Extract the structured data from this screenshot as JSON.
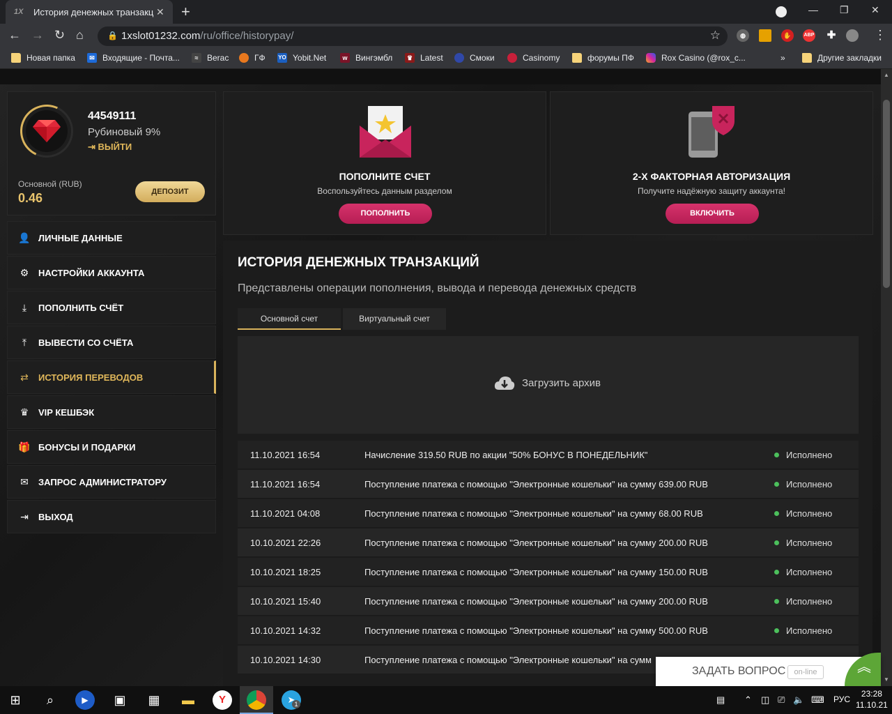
{
  "browser": {
    "tab_title": "История денежных транзакций",
    "tab_favicon": "1X",
    "url_host": "1xslot01232.com",
    "url_path": "/ru/office/historypay/",
    "bookmarks": [
      {
        "label": "Новая папка",
        "icon": "folder-icon"
      },
      {
        "label": "Входящие - Почта...",
        "icon": "mail-icon"
      },
      {
        "label": "Berac",
        "icon": "berac-icon"
      },
      {
        "label": "ГФ",
        "icon": "gf-icon"
      },
      {
        "label": "Yobit.Net",
        "icon": "yobit-icon"
      },
      {
        "label": "Вингэмбл",
        "icon": "wingamble-icon"
      },
      {
        "label": "Latest",
        "icon": "latest-icon"
      },
      {
        "label": "Смоки",
        "icon": "smoki-icon"
      },
      {
        "label": "Casinomy",
        "icon": "casinomy-icon"
      },
      {
        "label": "форумы ПФ",
        "icon": "folder-icon"
      },
      {
        "label": "Rox Casino (@rox_c...",
        "icon": "instagram-icon"
      }
    ],
    "more_bookmarks": "»",
    "other_bookmarks": "Другие закладки",
    "ext_abp": "ABP"
  },
  "profile": {
    "user_id": "44549111",
    "tier": "Рубиновый 9%",
    "logout": "ВЫЙТИ",
    "balance_label": "Основной (RUB)",
    "balance": "0.46",
    "deposit": "ДЕПОЗИТ"
  },
  "menu": [
    {
      "label": "ЛИЧНЫЕ ДАННЫЕ",
      "icon": "user-edit-icon"
    },
    {
      "label": "НАСТРОЙКИ АККАУНТА",
      "icon": "gears-icon"
    },
    {
      "label": "ПОПОЛНИТЬ СЧЁТ",
      "icon": "download-icon"
    },
    {
      "label": "ВЫВЕСТИ СО СЧЁТА",
      "icon": "upload-icon"
    },
    {
      "label": "ИСТОРИЯ ПЕРЕВОДОВ",
      "icon": "transfer-icon",
      "active": true
    },
    {
      "label": "VIP КЕШБЭК",
      "icon": "crown-icon"
    },
    {
      "label": "БОНУСЫ И ПОДАРКИ",
      "icon": "gift-icon"
    },
    {
      "label": "ЗАПРОС АДМИНИСТРАТОРУ",
      "icon": "envelope-icon"
    },
    {
      "label": "ВЫХОД",
      "icon": "exit-icon"
    }
  ],
  "promo_deposit": {
    "title": "ПОПОЛНИТЕ СЧЕТ",
    "subtitle": "Воспользуйтесь данным разделом",
    "button": "ПОПОЛНИТЬ"
  },
  "promo_2fa": {
    "title": "2-Х ФАКТОРНАЯ АВТОРИЗАЦИЯ",
    "subtitle": "Получите надёжную защиту аккаунта!",
    "button": "ВКЛЮЧИТЬ"
  },
  "history": {
    "title": "ИСТОРИЯ ДЕНЕЖНЫХ ТРАНЗАКЦИЙ",
    "subtitle": "Представлены операции пополнения, вывода и перевода денежных средств",
    "tabs": [
      "Основной счет",
      "Виртуальный счет"
    ],
    "archive": "Загрузить архив",
    "rows": [
      {
        "date": "11.10.2021 16:54",
        "desc": "Начисление 319.50 RUB по акции \"50% БОНУС В ПОНЕДЕЛЬНИК\"",
        "status": "Исполнено"
      },
      {
        "date": "11.10.2021 16:54",
        "desc": "Поступление платежа с помощью \"Электронные кошельки\" на сумму 639.00 RUB",
        "status": "Исполнено"
      },
      {
        "date": "11.10.2021 04:08",
        "desc": "Поступление платежа с помощью \"Электронные кошельки\" на сумму 68.00 RUB",
        "status": "Исполнено"
      },
      {
        "date": "10.10.2021 22:26",
        "desc": "Поступление платежа с помощью \"Электронные кошельки\" на сумму 200.00 RUB",
        "status": "Исполнено"
      },
      {
        "date": "10.10.2021 18:25",
        "desc": "Поступление платежа с помощью \"Электронные кошельки\" на сумму 150.00 RUB",
        "status": "Исполнено"
      },
      {
        "date": "10.10.2021 15:40",
        "desc": "Поступление платежа с помощью \"Электронные кошельки\" на сумму 200.00 RUB",
        "status": "Исполнено"
      },
      {
        "date": "10.10.2021 14:32",
        "desc": "Поступление платежа с помощью \"Электронные кошельки\" на сумму 500.00 RUB",
        "status": "Исполнено"
      },
      {
        "date": "10.10.2021 14:30",
        "desc": "Поступление платежа с помощью \"Электронные кошельки\" на сумм",
        "status": ""
      }
    ]
  },
  "chat": {
    "label": "ЗАДАТЬ ВОПРОС",
    "badge": "on-line"
  },
  "taskbar": {
    "lang": "РУС",
    "time": "23:28",
    "date": "11.10.21",
    "telegram_badge": "1"
  },
  "colors": {
    "accent_gold": "#d9b35c",
    "button_pink": "#c8245c",
    "status_green": "#4cc05c",
    "chat_green": "#5da637"
  }
}
